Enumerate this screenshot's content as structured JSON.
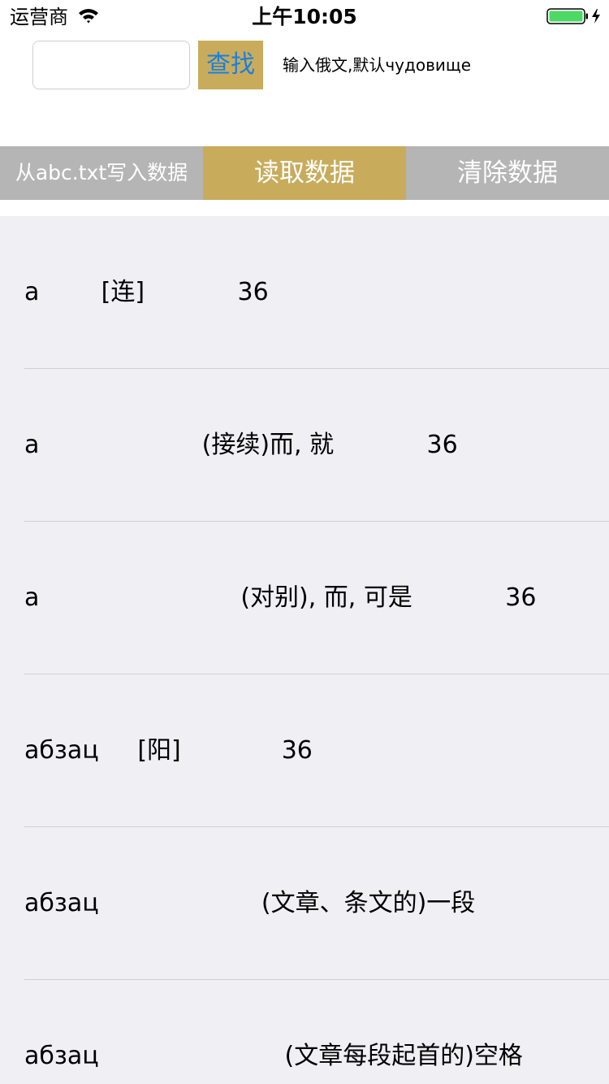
{
  "status_bar": {
    "carrier": "运营商",
    "time": "上午10:05"
  },
  "search": {
    "input_value": "",
    "placeholder": "",
    "button_label": "查找",
    "hint": "输入俄文,默认чудовище"
  },
  "actions": {
    "import_label": "从abc.txt写入数据",
    "read_label": "读取数据",
    "clear_label": "清除数据"
  },
  "list": {
    "rows": [
      {
        "text": "a        [连]            36"
      },
      {
        "text": "a                     (接续)而, 就            36"
      },
      {
        "text": "a                          (对别), 而, 可是            36"
      },
      {
        "text": "абзац     [阳]             36"
      },
      {
        "text": "абзац                     (文章、条文的)一段"
      },
      {
        "text": "абзац                        (文章每段起首的)空格"
      }
    ]
  },
  "colors": {
    "accent": "#c8ac5c",
    "button_gray": "#b5b5b5",
    "list_background": "#efeff4",
    "link_blue": "#1a7fe0",
    "battery_green": "#4cd964"
  }
}
